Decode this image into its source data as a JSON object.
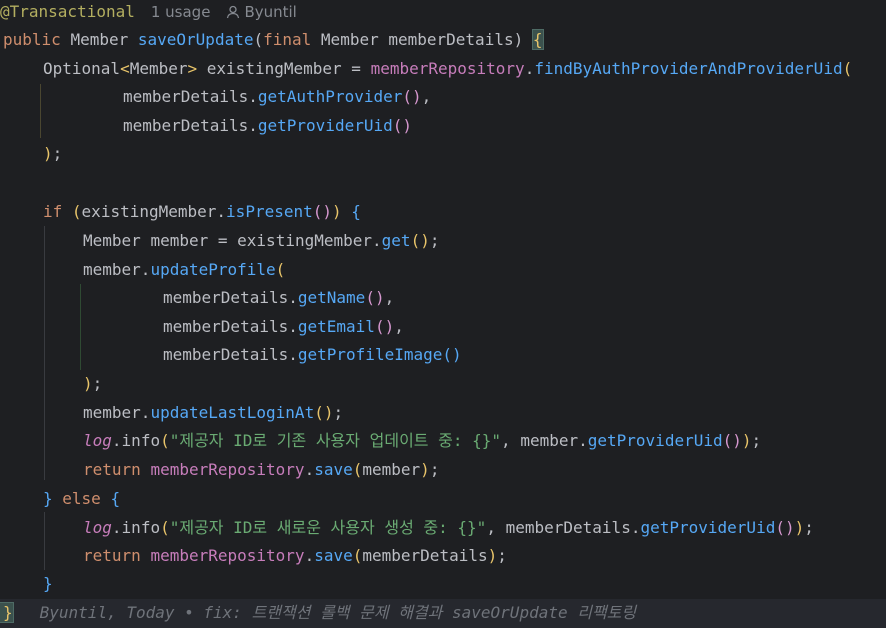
{
  "editor": {
    "hint": {
      "annotation": "@Transactional",
      "usages": "1 usage",
      "author": "Byuntil"
    },
    "lines": {
      "l1": {
        "kw": "public",
        "type": "Member",
        "method": "saveOrUpdate",
        "p_open": "(",
        "kw2": "final",
        "type2": "Member",
        "param": "memberDetails",
        "p_close": ")",
        "brace": "{"
      },
      "l2": {
        "type": "Optional",
        "gen_open": "<",
        "gen": "Member",
        "gen_close": ">",
        "var": "existingMember",
        "eq": "=",
        "repo": "memberRepository",
        "dot": ".",
        "method": "findByAuthProviderAndProviderUid",
        "paren": "("
      },
      "l3": {
        "obj": "memberDetails",
        "dot": ".",
        "method": "getAuthProvider",
        "paren": "()",
        "comma": ","
      },
      "l4": {
        "obj": "memberDetails",
        "dot": ".",
        "method": "getProviderUid",
        "paren": "()"
      },
      "l5": {
        "close": ")",
        "semi": ";"
      },
      "l6": {
        "kw": "if",
        "p_open": "(",
        "obj": "existingMember",
        "dot": ".",
        "method": "isPresent",
        "paren": "()",
        "p_close": ")",
        "brace": "{"
      },
      "l7": {
        "type": "Member",
        "var": "member",
        "eq": "=",
        "obj": "existingMember",
        "dot": ".",
        "method": "get",
        "paren": "()",
        "semi": ";"
      },
      "l8": {
        "obj": "member",
        "dot": ".",
        "method": "updateProfile",
        "paren": "("
      },
      "l9": {
        "obj": "memberDetails",
        "dot": ".",
        "method": "getName",
        "paren": "()",
        "comma": ","
      },
      "l10": {
        "obj": "memberDetails",
        "dot": ".",
        "method": "getEmail",
        "paren": "()",
        "comma": ","
      },
      "l11": {
        "obj": "memberDetails",
        "dot": ".",
        "method": "getProfileImage",
        "paren": "()"
      },
      "l12": {
        "close": ")",
        "semi": ";"
      },
      "l13": {
        "obj": "member",
        "dot": ".",
        "method": "updateLastLoginAt",
        "paren": "()",
        "semi": ";"
      },
      "l14": {
        "log": "log",
        "dot": ".",
        "method": "info",
        "p_open": "(",
        "str": "\"제공자 ID로 기존 사용자 업데이트 중: {}\"",
        "comma": ",",
        "obj": "member",
        "dot2": ".",
        "method2": "getProviderUid",
        "paren2": "()",
        "p_close": ")",
        "semi": ";"
      },
      "l15": {
        "kw": "return",
        "repo": "memberRepository",
        "dot": ".",
        "method": "save",
        "p_open": "(",
        "arg": "member",
        "p_close": ")",
        "semi": ";"
      },
      "l16": {
        "brace": "}",
        "kw": "else",
        "brace2": "{"
      },
      "l17": {
        "log": "log",
        "dot": ".",
        "method": "info",
        "p_open": "(",
        "str": "\"제공자 ID로 새로운 사용자 생성 중: {}\"",
        "comma": ",",
        "obj": "memberDetails",
        "dot2": ".",
        "method2": "getProviderUid",
        "paren2": "()",
        "p_close": ")",
        "semi": ";"
      },
      "l18": {
        "kw": "return",
        "repo": "memberRepository",
        "dot": ".",
        "method": "save",
        "p_open": "(",
        "arg": "memberDetails",
        "p_close": ")",
        "semi": ";"
      },
      "l19": {
        "brace": "}"
      },
      "l20": {
        "brace": "}",
        "blame": "Byuntil, Today • fix: 트랜잭션 롤백 문제 해결과 saveOrUpdate 리팩토링"
      }
    }
  }
}
